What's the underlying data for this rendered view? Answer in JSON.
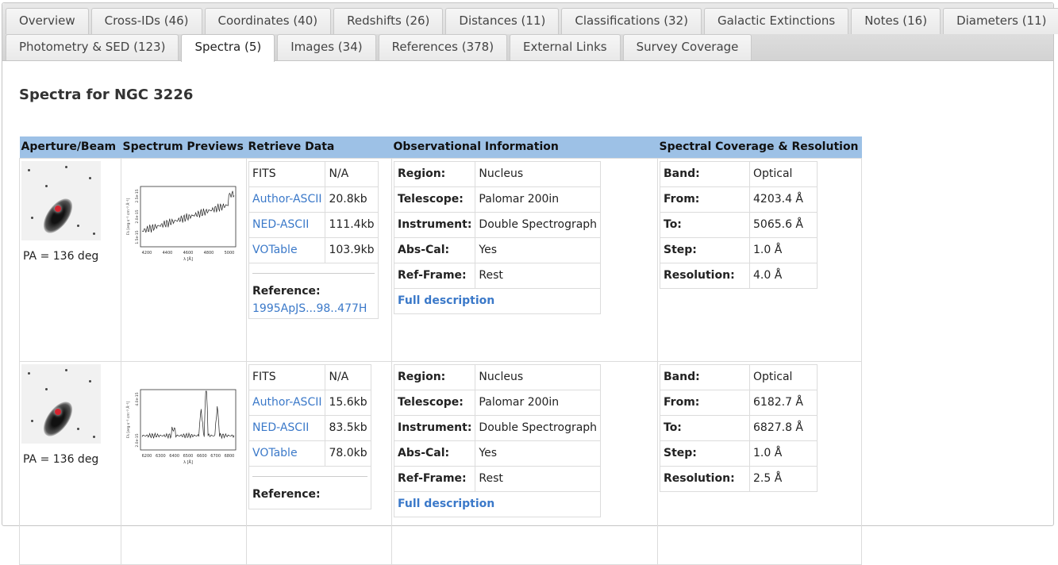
{
  "tabs": {
    "row1": [
      "Overview",
      "Cross-IDs (46)",
      "Coordinates (40)",
      "Redshifts (26)",
      "Distances (11)",
      "Classifications (32)",
      "Galactic Extinctions",
      "Notes (16)",
      "Diameters (11)"
    ],
    "row2": [
      "Photometry & SED (123)",
      "Spectra (5)",
      "Images (34)",
      "References (378)",
      "External Links",
      "Survey Coverage"
    ],
    "active": "Spectra (5)"
  },
  "page_title": "Spectra for NGC 3226",
  "columns": [
    "Aperture/Beam",
    "Spectrum Previews",
    "Retrieve Data",
    "Observational Information",
    "Spectral Coverage & Resolution"
  ],
  "rows": [
    {
      "pa": "PA = 136 deg",
      "preview": {
        "ylabel": "Fλ [erg s⁻¹ cm⁻² Å⁻¹]",
        "xlabel": "λ [Å]",
        "xticks": [
          "4200",
          "4400",
          "4600",
          "4800",
          "5000"
        ],
        "yticks": [
          "1.5e-15",
          "2.0e-15",
          "2.5e-15"
        ]
      },
      "retrieve": {
        "fits_label": "FITS",
        "fits_size": "N/A",
        "author_label": "Author-ASCII",
        "author_size": "20.8kb",
        "ned_label": "NED-ASCII",
        "ned_size": "111.4kb",
        "vot_label": "VOTable",
        "vot_size": "103.9kb",
        "ref_label": "Reference:",
        "ref_code": "1995ApJS...98..477H"
      },
      "obs": {
        "region_label": "Region:",
        "region": "Nucleus",
        "telescope_label": "Telescope:",
        "telescope": "Palomar 200in",
        "instrument_label": "Instrument:",
        "instrument": "Double Spectrograph",
        "abscal_label": "Abs-Cal:",
        "abscal": "Yes",
        "refframe_label": "Ref-Frame:",
        "refframe": "Rest",
        "full_label": "Full description"
      },
      "coverage": {
        "band_label": "Band:",
        "band": "Optical",
        "from_label": "From:",
        "from": "4203.4 Å",
        "to_label": "To:",
        "to": "5065.6 Å",
        "step_label": "Step:",
        "step": "1.0 Å",
        "res_label": "Resolution:",
        "res": "4.0 Å"
      }
    },
    {
      "pa": "PA = 136 deg",
      "preview": {
        "ylabel": "Fλ [erg s⁻¹ cm⁻² Å⁻¹]",
        "xlabel": "λ [Å]",
        "xticks": [
          "6200",
          "6300",
          "6400",
          "6500",
          "6600",
          "6700",
          "6800"
        ],
        "yticks": [
          "2.0e-15",
          "4.0e-15"
        ]
      },
      "retrieve": {
        "fits_label": "FITS",
        "fits_size": "N/A",
        "author_label": "Author-ASCII",
        "author_size": "15.6kb",
        "ned_label": "NED-ASCII",
        "ned_size": "83.5kb",
        "vot_label": "VOTable",
        "vot_size": "78.0kb",
        "ref_label": "Reference:",
        "ref_code": ""
      },
      "obs": {
        "region_label": "Region:",
        "region": "Nucleus",
        "telescope_label": "Telescope:",
        "telescope": "Palomar 200in",
        "instrument_label": "Instrument:",
        "instrument": "Double Spectrograph",
        "abscal_label": "Abs-Cal:",
        "abscal": "Yes",
        "refframe_label": "Ref-Frame:",
        "refframe": "Rest",
        "full_label": "Full description"
      },
      "coverage": {
        "band_label": "Band:",
        "band": "Optical",
        "from_label": "From:",
        "from": "6182.7 Å",
        "to_label": "To:",
        "to": "6827.8 Å",
        "step_label": "Step:",
        "step": "1.0 Å",
        "res_label": "Resolution:",
        "res": "2.5 Å"
      }
    }
  ]
}
